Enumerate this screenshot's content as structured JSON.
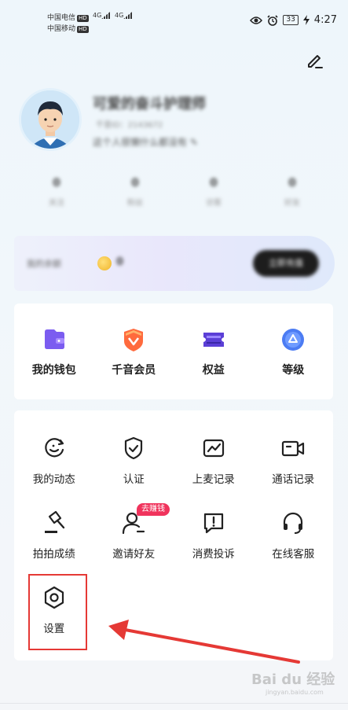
{
  "status_bar": {
    "carrier1": "中国电信",
    "carrier2": "中国移动",
    "hd": "HD",
    "net1": "4G",
    "net2": "4G",
    "battery": "33",
    "time": "4:27"
  },
  "profile": {
    "name": "可爱的奋斗护理师",
    "uid": "千音ID：2143672",
    "signature": "这个人很懒什么都没有",
    "stats": [
      {
        "value": "0",
        "label": "关注"
      },
      {
        "value": "0",
        "label": "粉丝"
      },
      {
        "value": "0",
        "label": "访客"
      },
      {
        "value": "0",
        "label": "好友"
      }
    ]
  },
  "banner": {
    "text": "我的余额",
    "count": "0",
    "button": "立即充值"
  },
  "quick_menu": [
    {
      "label": "我的钱包",
      "icon": "wallet-icon"
    },
    {
      "label": "千音会员",
      "icon": "vip-badge-icon"
    },
    {
      "label": "权益",
      "icon": "ticket-icon"
    },
    {
      "label": "等级",
      "icon": "level-icon"
    }
  ],
  "services": [
    {
      "label": "我的动态",
      "icon": "dynamic-icon"
    },
    {
      "label": "认证",
      "icon": "shield-check-icon"
    },
    {
      "label": "上麦记录",
      "icon": "chart-record-icon"
    },
    {
      "label": "通话记录",
      "icon": "video-call-icon"
    },
    {
      "label": "拍拍成绩",
      "icon": "gavel-icon"
    },
    {
      "label": "邀请好友",
      "icon": "person-add-icon"
    },
    {
      "label": "消费投诉",
      "icon": "complaint-icon"
    },
    {
      "label": "在线客服",
      "icon": "headset-icon"
    },
    {
      "label": "设置",
      "icon": "settings-hex-icon"
    }
  ],
  "invite_badge": "去赚钱",
  "watermark": {
    "brand": "Bai du 经验",
    "url": "jingyan.baidu.com"
  },
  "colors": {
    "accent": "#f0335c",
    "highlight": "#e53935",
    "primary_purple": "#6c5ce7"
  }
}
